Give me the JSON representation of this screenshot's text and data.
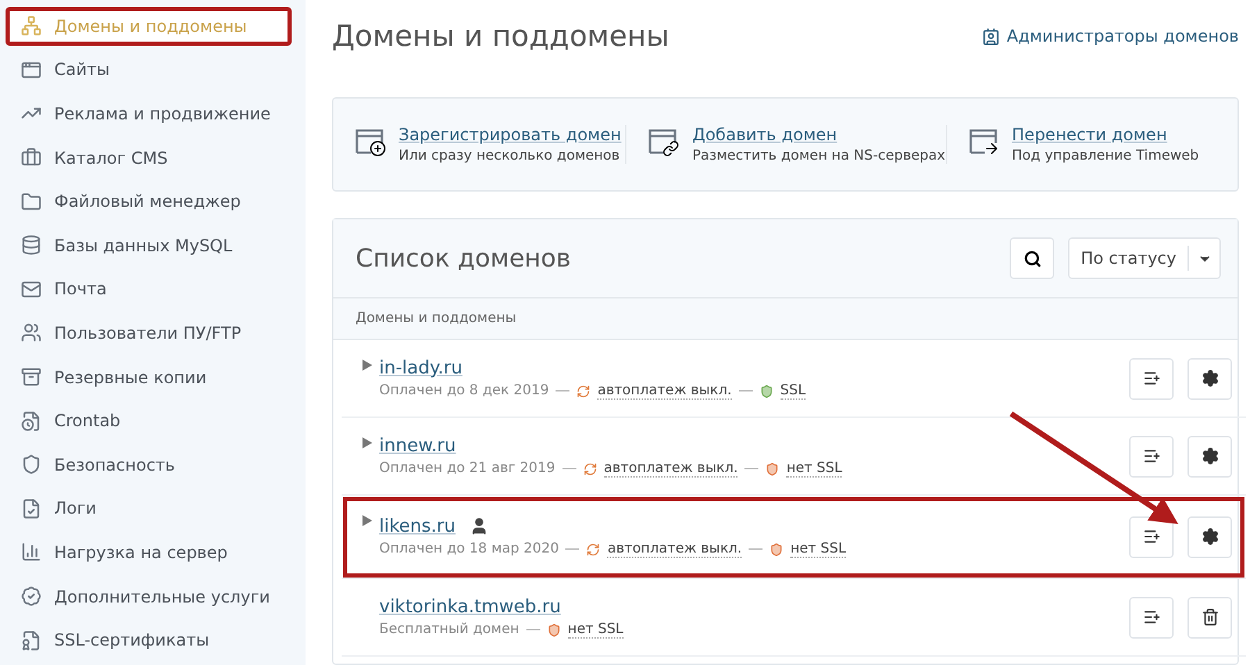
{
  "sidebar": {
    "items": [
      {
        "label": "Домены и поддомены",
        "selected": true,
        "highlighted": true
      },
      {
        "label": "Сайты",
        "selected": false,
        "highlighted": false
      },
      {
        "label": "Реклама и продвижение",
        "selected": false,
        "highlighted": false
      },
      {
        "label": "Каталог CMS",
        "selected": false,
        "highlighted": false
      },
      {
        "label": "Файловый менеджер",
        "selected": false,
        "highlighted": false
      },
      {
        "label": "Базы данных MySQL",
        "selected": false,
        "highlighted": false
      },
      {
        "label": "Почта",
        "selected": false,
        "highlighted": false
      },
      {
        "label": "Пользователи ПУ/FTP",
        "selected": false,
        "highlighted": false
      },
      {
        "label": "Резервные копии",
        "selected": false,
        "highlighted": false
      },
      {
        "label": "Crontab",
        "selected": false,
        "highlighted": false
      },
      {
        "label": "Безопасность",
        "selected": false,
        "highlighted": false
      },
      {
        "label": "Логи",
        "selected": false,
        "highlighted": false
      },
      {
        "label": "Нагрузка на сервер",
        "selected": false,
        "highlighted": false
      },
      {
        "label": "Дополнительные услуги",
        "selected": false,
        "highlighted": false
      },
      {
        "label": "SSL-сертификаты",
        "selected": false,
        "highlighted": false
      }
    ]
  },
  "page": {
    "title": "Домены и поддомены",
    "admin_link": "Администраторы доменов"
  },
  "actions": [
    {
      "title": "Зарегистрировать домен",
      "subtitle": "Или сразу несколько доменов"
    },
    {
      "title": "Добавить домен",
      "subtitle": "Разместить домен на NS-серверах"
    },
    {
      "title": "Перенести домен",
      "subtitle": "Под управление Timeweb"
    }
  ],
  "domain_list": {
    "title": "Список доменов",
    "filter": "По статусу",
    "group_label": "Домены и поддомены",
    "rows": [
      {
        "name": "in-lady.ru",
        "expandable": true,
        "owner_icon": false,
        "status": "Оплачен до 8 дек 2019",
        "autopay": "автоплатеж выкл.",
        "ssl": "SSL",
        "ssl_ok": true,
        "kind": "settings",
        "highlighted": false
      },
      {
        "name": "innew.ru",
        "expandable": true,
        "owner_icon": false,
        "status": "Оплачен до 21 авг 2019",
        "autopay": "автоплатеж выкл.",
        "ssl": "нет SSL",
        "ssl_ok": false,
        "kind": "settings",
        "highlighted": false
      },
      {
        "name": "likens.ru",
        "expandable": true,
        "owner_icon": true,
        "status": "Оплачен до 18 мар 2020",
        "autopay": "автоплатеж выкл.",
        "ssl": "нет SSL",
        "ssl_ok": false,
        "kind": "settings",
        "highlighted": true
      },
      {
        "name": "viktorinka.tmweb.ru",
        "expandable": false,
        "owner_icon": false,
        "status": "Бесплатный домен",
        "ssl": "нет SSL",
        "ssl_ok": false,
        "kind": "delete",
        "highlighted": false
      }
    ]
  },
  "annotation": {
    "arrow": true
  }
}
